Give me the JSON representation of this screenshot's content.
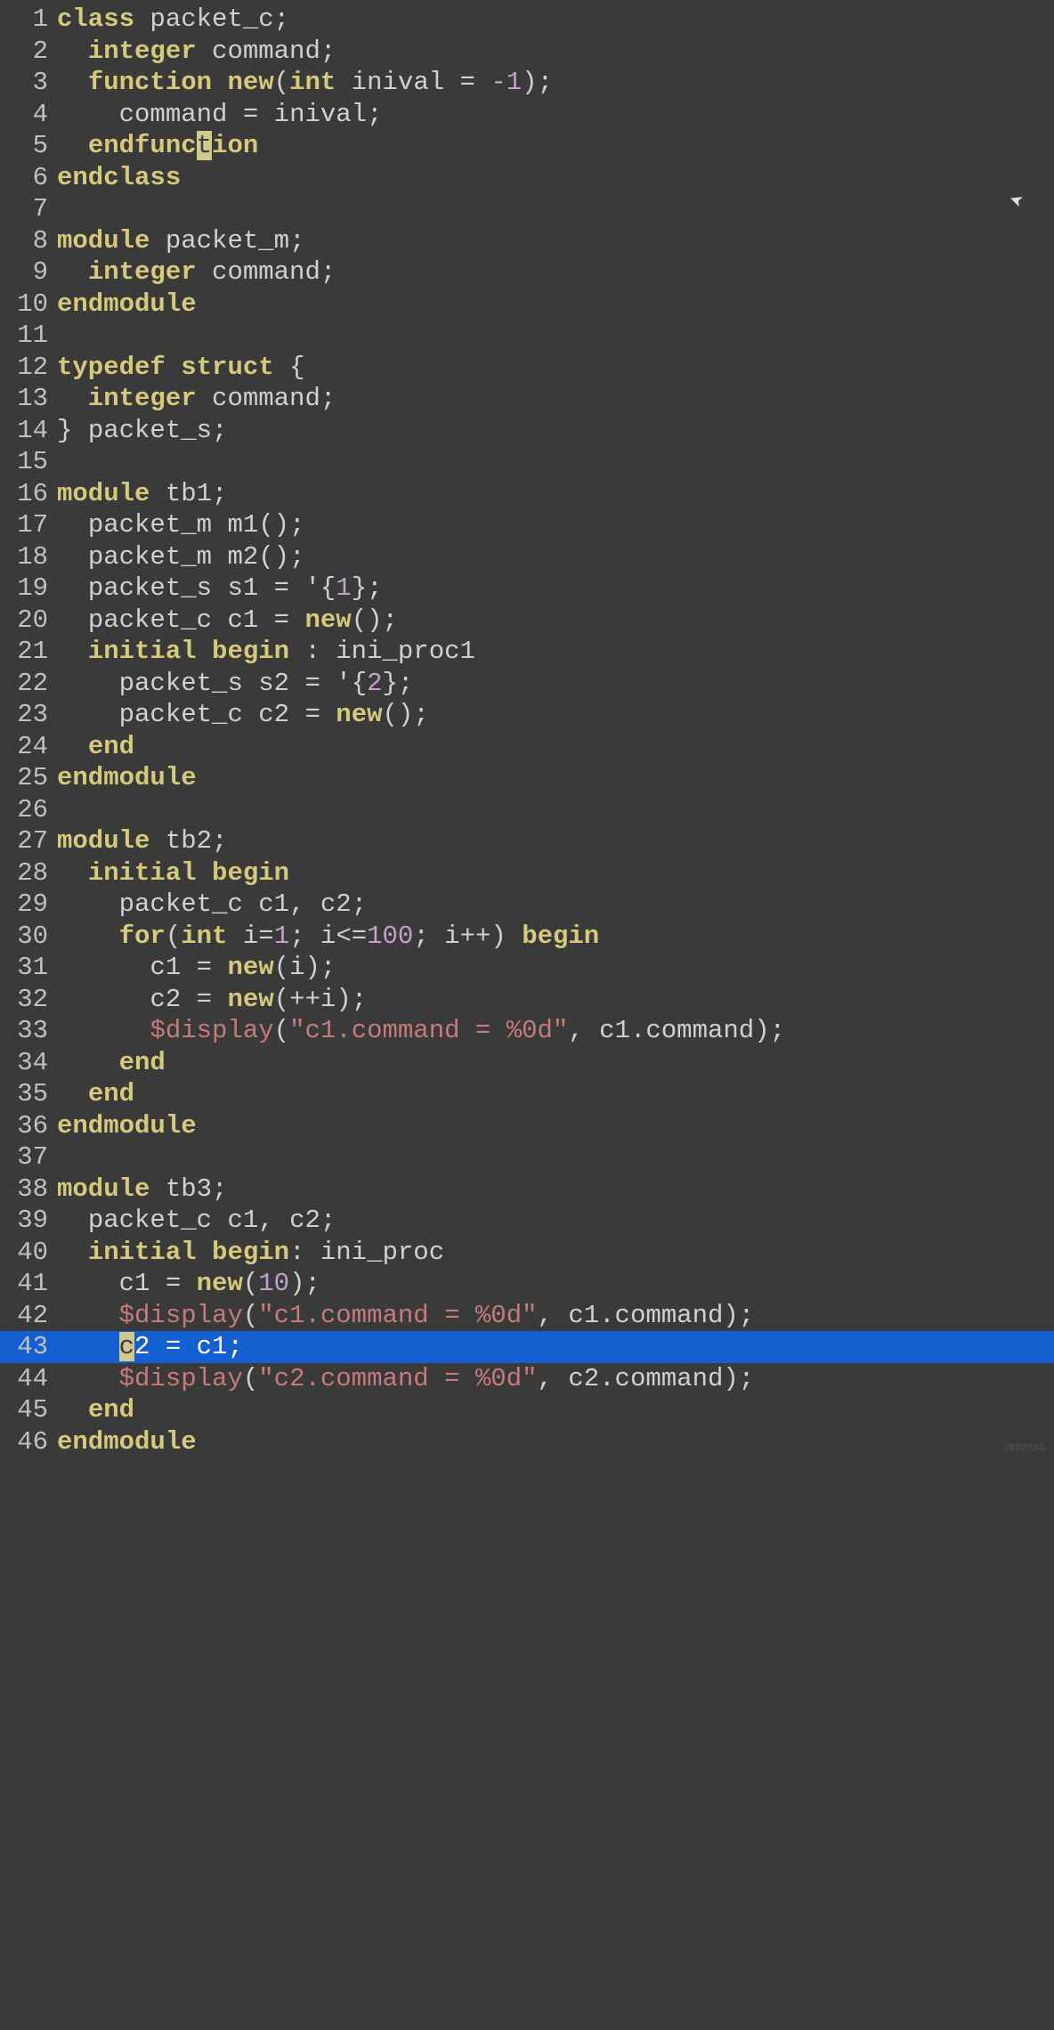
{
  "cursor_line5_char": "t",
  "cursor_line43_char": "c",
  "watermark": "anonss",
  "lines": {
    "l01": {
      "n": "1"
    },
    "l02": {
      "n": "2"
    },
    "l03": {
      "n": "3"
    },
    "l04": {
      "n": "4"
    },
    "l05": {
      "n": "5"
    },
    "l06": {
      "n": "6"
    },
    "l07": {
      "n": "7"
    },
    "l08": {
      "n": "8"
    },
    "l09": {
      "n": "9"
    },
    "l10": {
      "n": "10"
    },
    "l11": {
      "n": "11"
    },
    "l12": {
      "n": "12"
    },
    "l13": {
      "n": "13"
    },
    "l14": {
      "n": "14"
    },
    "l15": {
      "n": "15"
    },
    "l16": {
      "n": "16"
    },
    "l17": {
      "n": "17"
    },
    "l18": {
      "n": "18"
    },
    "l19": {
      "n": "19"
    },
    "l20": {
      "n": "20"
    },
    "l21": {
      "n": "21"
    },
    "l22": {
      "n": "22"
    },
    "l23": {
      "n": "23"
    },
    "l24": {
      "n": "24"
    },
    "l25": {
      "n": "25"
    },
    "l26": {
      "n": "26"
    },
    "l27": {
      "n": "27"
    },
    "l28": {
      "n": "28"
    },
    "l29": {
      "n": "29"
    },
    "l30": {
      "n": "30"
    },
    "l31": {
      "n": "31"
    },
    "l32": {
      "n": "32"
    },
    "l33": {
      "n": "33"
    },
    "l34": {
      "n": "34"
    },
    "l35": {
      "n": "35"
    },
    "l36": {
      "n": "36"
    },
    "l37": {
      "n": "37"
    },
    "l38": {
      "n": "38"
    },
    "l39": {
      "n": "39"
    },
    "l40": {
      "n": "40"
    },
    "l41": {
      "n": "41"
    },
    "l42": {
      "n": "42"
    },
    "l43": {
      "n": "43"
    },
    "l44": {
      "n": "44"
    },
    "l45": {
      "n": "45"
    },
    "l46": {
      "n": "46"
    }
  },
  "tok": {
    "class": "class",
    "endclass": "endclass",
    "integer": "integer",
    "function": "function",
    "endfunc_pre": "endfunc",
    "endfunc_suf": "ion",
    "int": "int",
    "module": "module",
    "endmodule": "endmodule",
    "typedef": "typedef",
    "struct": "struct",
    "begin": "begin",
    "end": "end",
    "initial": "initial",
    "for": "for",
    "new": "new",
    "display": "$display",
    "packet_c": "packet_c",
    "packet_m": "packet_m",
    "packet_s": "packet_s",
    "command": "command",
    "inival": "inival",
    "tb1": "tb1",
    "tb2": "tb2",
    "tb3": "tb3",
    "m1": "m1",
    "m2": "m2",
    "s1": "s1",
    "s2": "s2",
    "c1": "c1",
    "c2": "c2",
    "c2_suf": "2",
    "i": "i",
    "ini_proc1": "ini_proc1",
    "ini_proc": "ini_proc",
    "str_c1": "\"c1.command = %0d\"",
    "str_c2": "\"c2.command = %0d\"",
    "neg1": "-1",
    "n1": "1",
    "n2": "2",
    "n10": "10",
    "n100": "100",
    "c1cmd": "c1.command",
    "c2cmd": "c2.command",
    "semi": ";",
    "comma": ",",
    "colon": ":",
    "eq": "=",
    "op": "(",
    "cp": ")",
    "ob": "{",
    "cb": "}",
    "tick": "'",
    "le": "<=",
    "pp": "++",
    "sp1": " ",
    "sp2": "  ",
    "sp3": "   ",
    "sp4": "    ",
    "sp5": "     "
  }
}
